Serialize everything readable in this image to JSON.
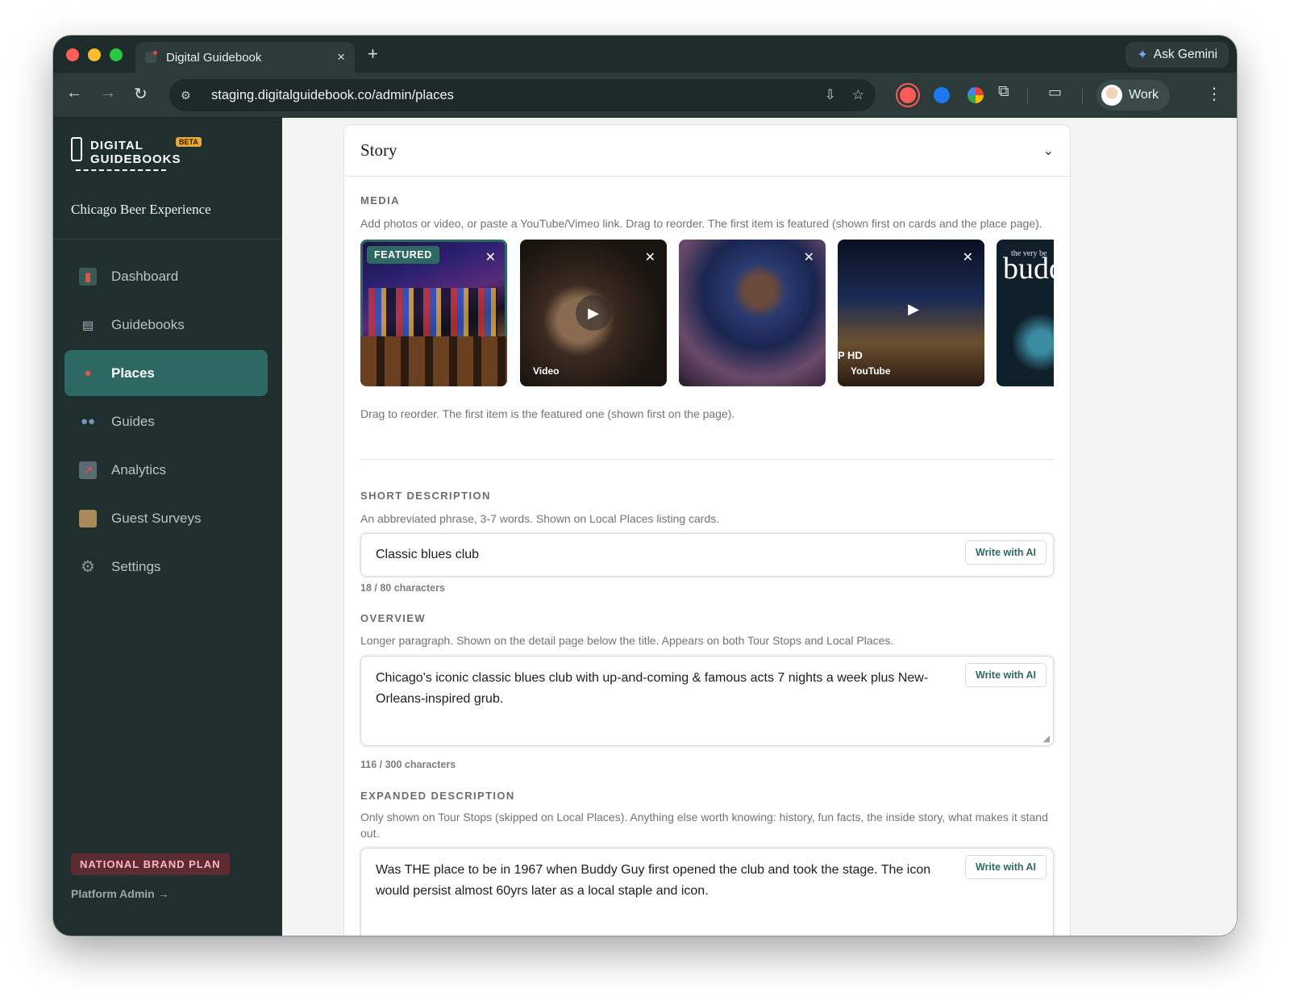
{
  "browser": {
    "tab_title": "Digital Guidebook",
    "tab_close": "×",
    "new_tab": "+",
    "ask_gemini": "Ask Gemini",
    "url": "staging.digitalguidebook.co/admin/places",
    "profile_label": "Work"
  },
  "sidebar": {
    "logo_line1": "DIGITAL",
    "logo_line2": "GUIDEBOOKS",
    "beta": "BETA",
    "org_name": "Chicago Beer Experience",
    "items": [
      {
        "label": "Dashboard",
        "icon": "bar-chart-icon"
      },
      {
        "label": "Guidebooks",
        "icon": "book-icon"
      },
      {
        "label": "Places",
        "icon": "map-pin-icon"
      },
      {
        "label": "Guides",
        "icon": "people-icon"
      },
      {
        "label": "Analytics",
        "icon": "trend-chart-icon"
      },
      {
        "label": "Guest Surveys",
        "icon": "clipboard-icon"
      },
      {
        "label": "Settings",
        "icon": "gear-icon"
      }
    ],
    "active_item": "Places",
    "plan_badge": "NATIONAL BRAND PLAN",
    "platform_admin": "Platform Admin →"
  },
  "story": {
    "title": "Story",
    "media": {
      "label": "MEDIA",
      "help": "Add photos or video, or paste a YouTube/Vimeo link. Drag to reorder. The first item is featured (shown first on cards and the place page).",
      "featured_badge": "FEATURED",
      "items": [
        {
          "kind": "photo",
          "tag": ""
        },
        {
          "kind": "video",
          "tag": "Video"
        },
        {
          "kind": "photo",
          "tag": ""
        },
        {
          "kind": "youtube",
          "tag": "YouTube",
          "overlay": "P HD"
        },
        {
          "kind": "photo",
          "tag": "",
          "overlay_small": "the very be",
          "overlay_big": "budd guy"
        }
      ],
      "footer": "Drag to reorder. The first item is the featured one (shown first on the page)."
    },
    "short_description": {
      "label": "SHORT DESCRIPTION",
      "help": "An abbreviated phrase, 3-7 words. Shown on Local Places listing cards.",
      "value": "Classic blues club",
      "ai_button": "Write with AI",
      "counter": "18 / 80 characters"
    },
    "overview": {
      "label": "OVERVIEW",
      "help": "Longer paragraph. Shown on the detail page below the title. Appears on both Tour Stops and Local Places.",
      "value": "Chicago's iconic classic blues club with up-and-coming & famous acts 7 nights a week plus New-Orleans-inspired grub.",
      "ai_button": "Write with AI",
      "counter": "116 / 300 characters"
    },
    "expanded_description": {
      "label": "EXPANDED DESCRIPTION",
      "help": "Only shown on Tour Stops (skipped on Local Places). Anything else worth knowing: history, fun facts, the inside story, what makes it stand out.",
      "value": "Was THE place to be in 1967 when Buddy Guy first opened the club and took the stage. The icon would persist almost 60yrs later as a local staple and icon.",
      "ai_button": "Write with AI"
    }
  },
  "colors": {
    "sidebar_bg": "#1e2f2d",
    "accent": "#2e6862",
    "plan_badge_bg": "#5d2b32"
  }
}
